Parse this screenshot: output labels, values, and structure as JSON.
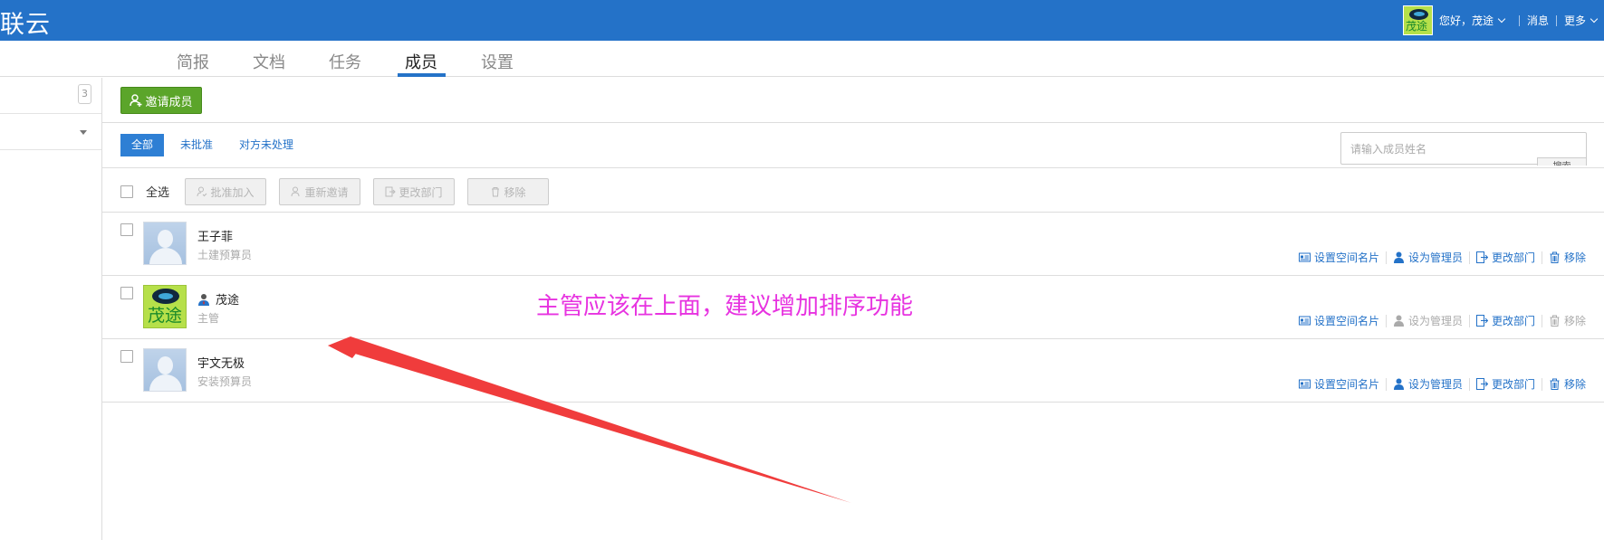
{
  "app": {
    "logo_text": "联云"
  },
  "user_menu": {
    "greeting": "您好，茂途",
    "messages": "消息",
    "more": "更多",
    "avatar_text": "茂途"
  },
  "tabs": [
    {
      "label": "简报"
    },
    {
      "label": "文档"
    },
    {
      "label": "任务"
    },
    {
      "label": "成员",
      "active": true
    },
    {
      "label": "设置"
    }
  ],
  "sidebar": {
    "count": "3"
  },
  "toolbar": {
    "invite_label": "邀请成员"
  },
  "filters": [
    {
      "label": "全部",
      "active": true
    },
    {
      "label": "未批准"
    },
    {
      "label": "对方未处理"
    }
  ],
  "search": {
    "placeholder": "请输入成员姓名",
    "button_label": "搜索"
  },
  "batch": {
    "select_all": "全选",
    "approve": "批准加入",
    "reinvite": "重新邀请",
    "change_dept": "更改部门",
    "remove": "移除"
  },
  "members": [
    {
      "name": "王子菲",
      "role": "土建预算员",
      "is_manager": false
    },
    {
      "name": "茂途",
      "role": "主管",
      "is_manager": true,
      "avatar_text": "茂途"
    },
    {
      "name": "宇文无极",
      "role": "安装预算员",
      "is_manager": false
    }
  ],
  "row_actions": {
    "set_card": "设置空间名片",
    "set_admin": "设为管理员",
    "change_dept": "更改部门",
    "remove": "移除"
  },
  "annotation": {
    "text": "主管应该在上面，建议增加排序功能",
    "color": "#e733e0"
  },
  "colors": {
    "brand": "#2472c8",
    "invite_green": "#5ba52a",
    "annotation": "#e733e0",
    "arrow": "#f03c3c"
  }
}
